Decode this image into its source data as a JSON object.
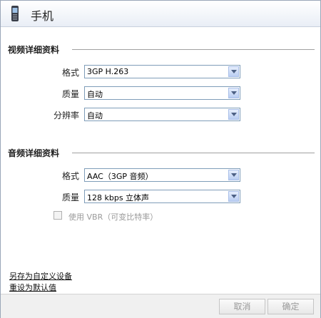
{
  "title": "手机",
  "video": {
    "header": "视频详细资料",
    "format_label": "格式",
    "format_value": "3GP H.263",
    "quality_label": "质量",
    "quality_value": "自动",
    "resolution_label": "分辨率",
    "resolution_value": "自动"
  },
  "audio": {
    "header": "音频详细资料",
    "format_label": "格式",
    "format_value": "AAC（3GP 音频）",
    "quality_label": "质量",
    "quality_value": "128 kbps 立体声",
    "vbr_label": "使用 VBR（可变比特率）"
  },
  "links": {
    "save_custom": "另存为自定义设备",
    "reset_default": "重设为默认值"
  },
  "buttons": {
    "cancel": "取消",
    "ok": "确定"
  },
  "colors": {
    "accent": "#7f9db9",
    "disabled_text": "#9a9a9a"
  }
}
